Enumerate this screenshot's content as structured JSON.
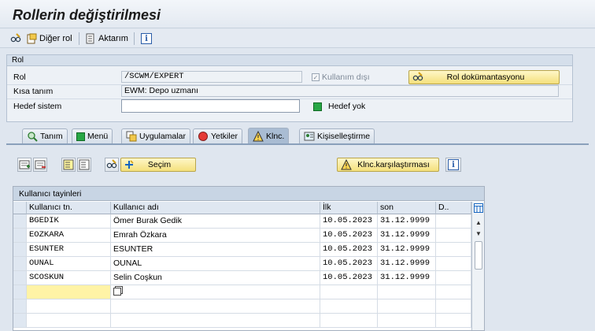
{
  "window": {
    "title": "Rollerin değiştirilmesi"
  },
  "toolbar": {
    "other_role": "Diğer rol",
    "transfer": "Aktarım"
  },
  "role_group": {
    "header": "Rol",
    "role_label": "Rol",
    "role_value": "/SCWM/EXPERT",
    "inactive_label": "Kullanım dışı",
    "doc_button": "Rol dokümantasyonu",
    "short_desc_label": "Kısa tanım",
    "short_desc_value": "EWM: Depo uzmanı",
    "target_system_label": "Hedef sistem",
    "target_system_value": "",
    "no_target_label": "Hedef yok"
  },
  "tabs": [
    "Tanım",
    "Menü",
    "Uygulamalar",
    "Yetkiler",
    "Klnc.",
    "Kişiselleştirme"
  ],
  "active_tab": "Klnc.",
  "user_tab": {
    "selection_button": "Seçim",
    "compare_button": "Klnc.karşılaştırması"
  },
  "user_table": {
    "title": "Kullanıcı tayinleri",
    "columns": [
      "Kullanıcı tn.",
      "Kullanıcı adı",
      "İlk",
      "son",
      "D.."
    ],
    "rows": [
      [
        "BGEDIK",
        "Ömer Burak Gedik",
        "10.05.2023",
        "31.12.9999",
        ""
      ],
      [
        "EOZKARA",
        "Emrah Özkara",
        "10.05.2023",
        "31.12.9999",
        ""
      ],
      [
        "ESUNTER",
        "ESUNTER",
        "10.05.2023",
        "31.12.9999",
        ""
      ],
      [
        "OUNAL",
        "OUNAL",
        "10.05.2023",
        "31.12.9999",
        ""
      ],
      [
        "SCOSKUN",
        "Selin Coşkun",
        "10.05.2023",
        "31.12.9999",
        ""
      ]
    ]
  },
  "colors": {
    "accent_yellow": "#f4e07c",
    "status_green": "#28a745",
    "tab_active": "#a9bcd3",
    "input_highlight": "#fff3a6"
  }
}
